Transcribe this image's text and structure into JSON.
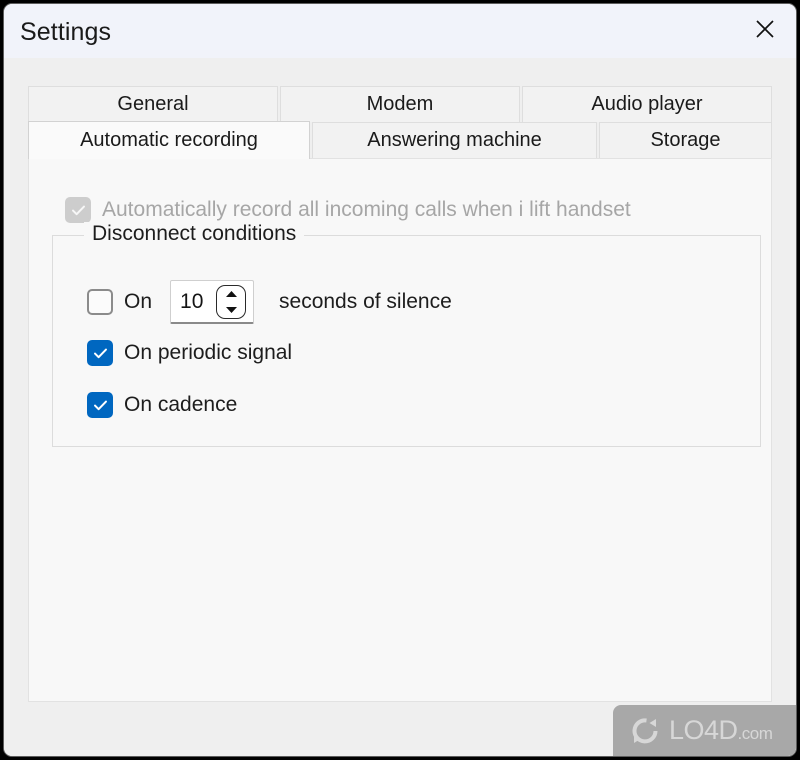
{
  "window": {
    "title": "Settings",
    "close_icon": "close-icon"
  },
  "tabs": {
    "row1": [
      {
        "label": "General",
        "selected": false
      },
      {
        "label": "Modem",
        "selected": false
      },
      {
        "label": "Audio player",
        "selected": false
      }
    ],
    "row2": [
      {
        "label": "Automatic recording",
        "selected": true
      },
      {
        "label": "Answering machine",
        "selected": false
      },
      {
        "label": "Storage",
        "selected": false
      }
    ]
  },
  "page": {
    "auto_record": {
      "label": "Automatically record all incoming calls when i lift handset",
      "checked": true,
      "enabled": false
    },
    "group": {
      "title": "Disconnect conditions",
      "silence": {
        "checkbox_label": "On",
        "checked": false,
        "value": "10",
        "suffix_label": "seconds of silence",
        "up_icon": "triangle-up-icon",
        "down_icon": "triangle-down-icon"
      },
      "options": [
        {
          "label": "On periodic signal",
          "checked": true
        },
        {
          "label": "On cadence",
          "checked": true
        }
      ]
    }
  },
  "watermark": {
    "name": "LO4D",
    "suffix": ".com",
    "logo_icon": "refresh-arrows-icon"
  },
  "colors": {
    "accent": "#0067c0",
    "disabled": "#cdcdcd",
    "titlebar": "#f1f3fa",
    "dialog": "#efefef",
    "page": "#f8f8f8"
  }
}
